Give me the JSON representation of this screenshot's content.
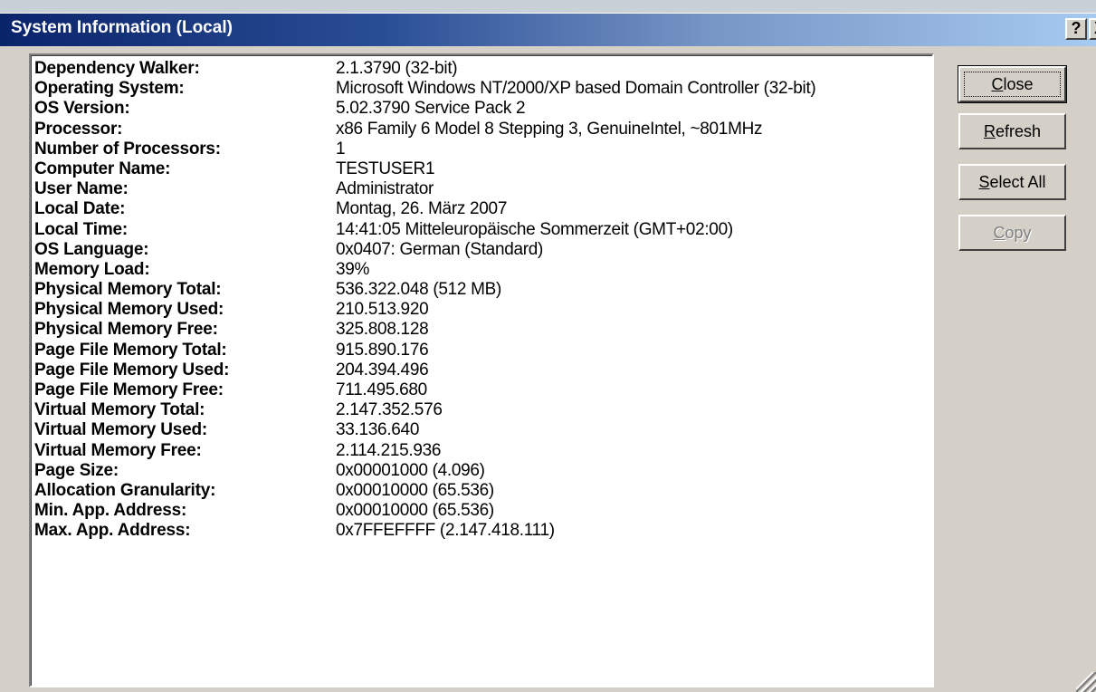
{
  "window": {
    "title": "System Information (Local)",
    "help_label": "?",
    "close_label": "X"
  },
  "info_rows": [
    {
      "label": "Dependency Walker:",
      "value": "2.1.3790 (32-bit)"
    },
    {
      "label": "Operating System:",
      "value": "Microsoft Windows NT/2000/XP based Domain Controller (32-bit)"
    },
    {
      "label": "OS Version:",
      "value": "5.02.3790 Service Pack 2"
    },
    {
      "label": "Processor:",
      "value": "x86 Family 6 Model 8 Stepping 3, GenuineIntel, ~801MHz"
    },
    {
      "label": "Number of Processors:",
      "value": "1"
    },
    {
      "label": "Computer Name:",
      "value": "TESTUSER1"
    },
    {
      "label": "User Name:",
      "value": "Administrator"
    },
    {
      "label": "Local Date:",
      "value": "Montag, 26. März 2007"
    },
    {
      "label": "Local Time:",
      "value": "14:41:05 Mitteleuropäische Sommerzeit   (GMT+02:00)"
    },
    {
      "label": "OS Language:",
      "value": "0x0407: German (Standard)"
    },
    {
      "label": "Memory Load:",
      "value": "39%"
    },
    {
      "label": "Physical Memory Total:",
      "value": "536.322.048 (512 MB)"
    },
    {
      "label": "Physical Memory Used:",
      "value": "210.513.920"
    },
    {
      "label": "Physical Memory Free:",
      "value": "325.808.128"
    },
    {
      "label": "Page File Memory Total:",
      "value": "915.890.176"
    },
    {
      "label": "Page File Memory Used:",
      "value": "204.394.496"
    },
    {
      "label": "Page File Memory Free:",
      "value": "711.495.680"
    },
    {
      "label": "Virtual Memory Total:",
      "value": "2.147.352.576"
    },
    {
      "label": "Virtual Memory Used:",
      "value": "33.136.640"
    },
    {
      "label": "Virtual Memory Free:",
      "value": "2.114.215.936"
    },
    {
      "label": "Page Size:",
      "value": "0x00001000 (4.096)"
    },
    {
      "label": "Allocation Granularity:",
      "value": "0x00010000 (65.536)"
    },
    {
      "label": "Min. App. Address:",
      "value": "0x00010000 (65.536)"
    },
    {
      "label": "Max. App. Address:",
      "value": "0x7FFEFFFF (2.147.418.111)"
    }
  ],
  "buttons": {
    "close": {
      "first": "C",
      "rest": "lose"
    },
    "refresh": {
      "first": "R",
      "rest": "efresh"
    },
    "select_all": {
      "first": "S",
      "rest": "elect All"
    },
    "copy": {
      "first": "C",
      "rest": "opy"
    }
  },
  "colors": {
    "titlebar_start": "#0a246a",
    "titlebar_end": "#a6caf0",
    "dialog_face": "#d4d0c8",
    "disabled_text": "#808080"
  }
}
